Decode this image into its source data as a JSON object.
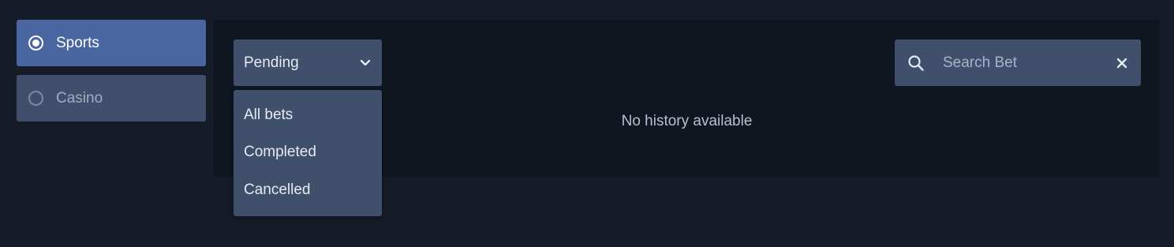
{
  "tabs": [
    {
      "label": "Sports",
      "selected": true
    },
    {
      "label": "Casino",
      "selected": false
    }
  ],
  "filter": {
    "selected": "Pending",
    "options": [
      "All bets",
      "Completed",
      "Cancelled"
    ]
  },
  "search": {
    "placeholder": "Search Bet",
    "value": ""
  },
  "empty_message": "No history available",
  "colors": {
    "page_bg": "#161b28",
    "panel_bg": "#0f1620",
    "active_tab": "#4a66a0",
    "control_bg": "#3f4f6c"
  },
  "icons": {
    "radio_selected": "radio-checked-icon",
    "radio_unselected": "radio-unchecked-icon",
    "dropdown": "chevron-down-icon",
    "search": "search-icon",
    "clear": "close-icon"
  }
}
